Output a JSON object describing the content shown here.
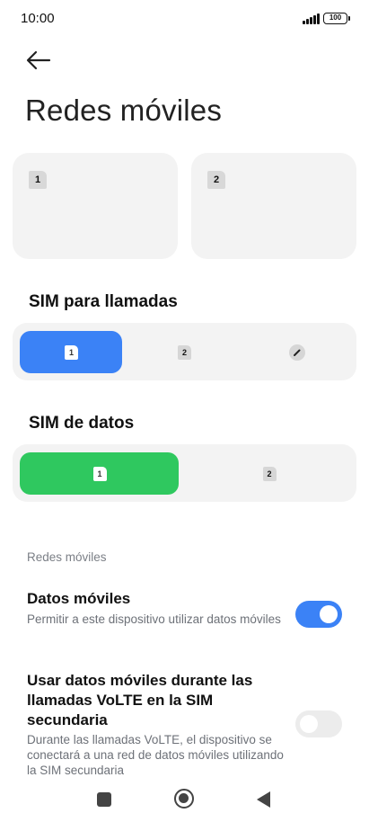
{
  "status_bar": {
    "time": "10:00",
    "battery": "100"
  },
  "page": {
    "title": "Redes móviles"
  },
  "sim_cards": [
    {
      "slot": "1"
    },
    {
      "slot": "2"
    }
  ],
  "calls_section": {
    "title": "SIM para llamadas",
    "options": [
      "1",
      "2",
      "edit"
    ],
    "selected": "1",
    "accent": "#3b82f6"
  },
  "data_section": {
    "title": "SIM de datos",
    "options": [
      "1",
      "2"
    ],
    "selected": "1",
    "accent": "#2fc85f"
  },
  "settings": {
    "group_label": "Redes móviles",
    "mobile_data": {
      "title": "Datos móviles",
      "description": "Permitir a este dispositivo utilizar datos móviles",
      "enabled": true
    },
    "volte_data": {
      "title": "Usar datos móviles durante las llamadas VoLTE en la SIM secundaria",
      "description": "Durante las llamadas VoLTE, el dispositivo se conectará a una red de datos móviles utilizando la SIM secundaria",
      "enabled": false
    }
  },
  "icons": {
    "back": "arrow-left-icon",
    "signal": "signal-icon",
    "battery": "battery-icon",
    "nav_recents": "square-icon",
    "nav_home": "circle-icon",
    "nav_back": "triangle-back-icon"
  }
}
